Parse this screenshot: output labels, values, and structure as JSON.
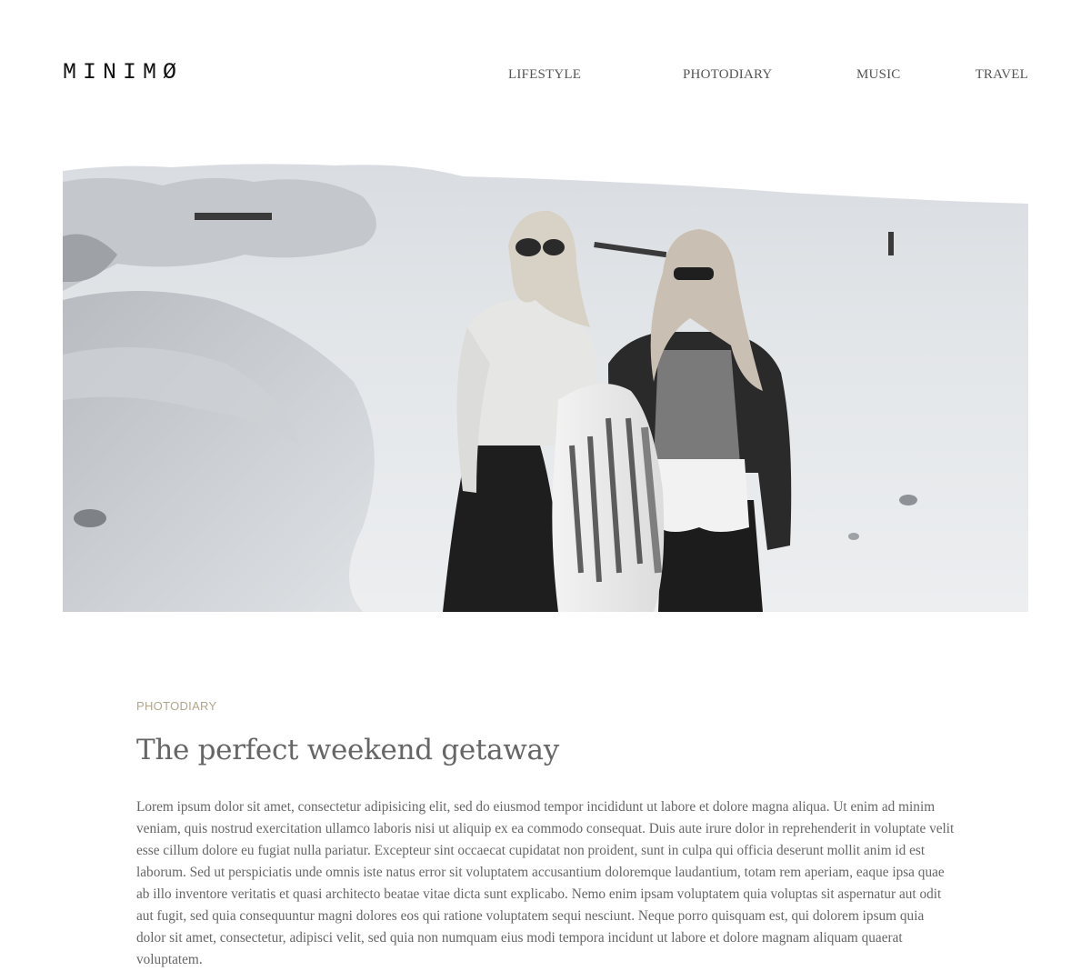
{
  "site": {
    "logo": "MINIMØ"
  },
  "nav": {
    "items": [
      "LIFESTYLE",
      "PHOTODIARY",
      "MUSIC",
      "TRAVEL"
    ]
  },
  "hero": {
    "alt": "Two women walking on a sandy dune landscape"
  },
  "article": {
    "category": "PHOTODIARY",
    "title": "The perfect weekend getaway",
    "body": "Lorem ipsum dolor sit amet, consectetur adipisicing elit, sed do eiusmod tempor incididunt ut labore et dolore magna aliqua. Ut enim ad minim veniam, quis nostrud exercitation ullamco laboris nisi ut aliquip ex ea commodo consequat. Duis aute irure dolor in reprehenderit in voluptate velit esse cillum dolore eu fugiat nulla pariatur. Excepteur sint occaecat cupidatat non proident, sunt in culpa qui officia deserunt mollit anim id est laborum. Sed ut perspiciatis unde omnis iste natus error sit voluptatem accusantium doloremque laudantium, totam rem aperiam, eaque ipsa quae ab illo inventore veritatis et quasi architecto beatae vitae dicta sunt explicabo. Nemo enim ipsam voluptatem quia voluptas sit aspernatur aut odit aut fugit, sed quia consequuntur magni dolores eos qui ratione voluptatem sequi nesciunt. Neque porro quisquam est, qui dolorem ipsum quia dolor sit amet, consectetur, adipisci velit, sed quia non numquam eius modi tempora incidunt ut labore et dolore magnam aliquam quaerat voluptatem."
  },
  "colors": {
    "accent": "#b0a68c",
    "text": "#666666",
    "logo": "#111111"
  }
}
